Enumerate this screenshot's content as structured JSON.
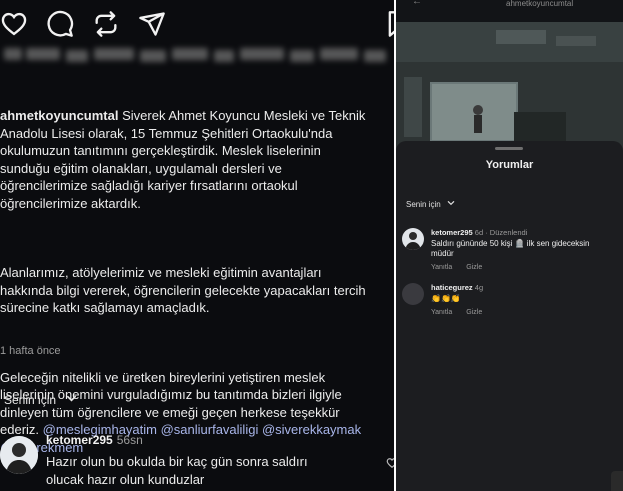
{
  "post": {
    "username": "ahmetkoyuncumtal",
    "caption_p1": "Siverek Ahmet Koyuncu Mesleki ve Teknik\nAnadolu Lisesi olarak, 15 Temmuz Şehitleri Ortaokulu'nda\nokulumuzun tanıtımını gerçekleştirdik. Meslek liselerinin\nsunduğu eğitim olanakları, uygulamalı dersleri ve\nöğrencilerimize sağladığı kariyer fırsatlarını ortaokul\nöğrencilerimize aktardık.",
    "caption_p2": "Alanlarımız, atölyelerimiz ve mesleki eğitimin avantajları\nhakkında bilgi vererek, öğrencilerin gelecekte yapacakları tercih\nsürecine katkı sağlamayı amaçladık.",
    "caption_p3": "Geleceğin nitelikli ve üretken bireylerini yetiştiren meslek\nliselerinin önemini vurguladığımız bu tanıtımda bizleri ilgiyle\ndinleyen tüm öğrencilere ve emeği geçen herkese teşekkür\nederiz. ",
    "hashtags": "@meslegimhayatim @sanliurfavaliligi @siverekkaymak\n@siverekmem",
    "time_ago": "1 hafta önce"
  },
  "comments_section": {
    "sort_label": "Senin için"
  },
  "comment": {
    "username": "ketomer295",
    "time": "56sn",
    "text": "Hazır olun bu okulda bir kaç gün sonra saldırı\nolucak hazır olun kunduzlar"
  },
  "right_panel": {
    "handle": "ahmetkoyuncumtal",
    "sheet_title": "Yorumlar",
    "sort_label": "Senin için",
    "comments": [
      {
        "username": "ketomer295",
        "meta": "6d · Düzenlendi",
        "text": "Saldırı gününde 50 kişi 🪦 ilk sen gideceksin\nmüdür",
        "reply": "Yanıtla",
        "hide": "Gizle"
      },
      {
        "username": "haticegurez",
        "meta": "4g",
        "text": "👏👏👏",
        "reply": "Yanıtla",
        "hide": "Gizle"
      }
    ]
  },
  "icons": {
    "like": "heart-icon",
    "comment": "comment-icon",
    "repost": "repost-icon",
    "share": "send-icon",
    "save": "bookmark-icon"
  },
  "colors": {
    "background": "#0b0c0f",
    "text": "#ececec",
    "hashtag": "#a9b6ea",
    "muted": "#9c9c9c",
    "sheet": "#1c1d20"
  }
}
